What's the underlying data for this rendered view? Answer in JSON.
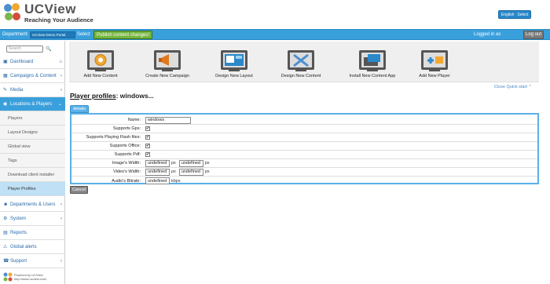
{
  "header": {
    "title": "UCView",
    "subtitle": "Reaching Your Audience",
    "language": "English",
    "language_select": "Select"
  },
  "topbar": {
    "department_label": "Department:",
    "department_value": "UCView Demo Portal",
    "department_select": "Select",
    "publish_label": "Publish content changes!",
    "logged_in": "Logged in as",
    "logout": "Log out"
  },
  "sidebar": {
    "search_placeholder": "Search",
    "search_button": "Go",
    "items": [
      {
        "label": "Dashboard"
      },
      {
        "label": "Campaigns & Content"
      },
      {
        "label": "Media"
      },
      {
        "label": "Locations & Players"
      },
      {
        "label": "Departments & Users"
      },
      {
        "label": "System"
      },
      {
        "label": "Reports"
      },
      {
        "label": "Global alerts"
      },
      {
        "label": "Support"
      }
    ],
    "subitems": [
      "Players",
      "Layout Designs",
      "Global view",
      "Tags",
      "Download client installer",
      "Player Profiles"
    ],
    "powered": "Powered by UCView",
    "powered_url": "http://www.ucview.com/"
  },
  "quickstart": {
    "items": [
      "Add New Content",
      "Create New Campaign",
      "Design New Layout",
      "Design New Content",
      "Install New Content App",
      "Add New Player"
    ],
    "close": "Close Quick start"
  },
  "page": {
    "title_link": "Player profiles",
    "title_rest": ": windows...",
    "tab": "details",
    "cancel": "Cancel"
  },
  "form": {
    "name_label": "Name:",
    "name_value": "windows",
    "gps_label": "Supports Gps:",
    "flash_label": "Supports Playing Flash files:",
    "office_label": "Supports Office:",
    "pdf_label": "Supports Pdf:",
    "image_width_label": "Image's Width:",
    "image_w1": "undefined",
    "image_w2": "undefined",
    "video_width_label": "Video's Width:",
    "video_w1": "undefined",
    "video_w2": "undefined",
    "audio_label": "Audio's Bitrate:",
    "audio_value": "undefined",
    "unit_px": "px",
    "unit_kbps": "kbps",
    "checked": "✔"
  },
  "colors": {
    "accent": "#3aa0dc",
    "publish": "#74b53c"
  }
}
